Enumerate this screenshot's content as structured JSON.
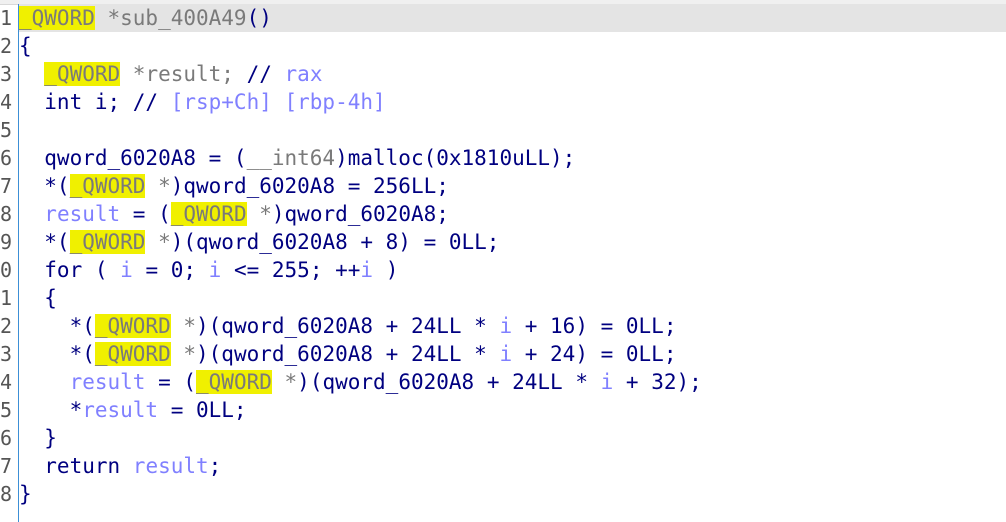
{
  "editor": {
    "current_line": 1,
    "colors": {
      "keyword": "#000080",
      "type": "#7a7a7a",
      "variable": "#8080ff",
      "highlight": "#f0f000"
    },
    "lines": [
      {
        "num": "1",
        "tokens": [
          [
            "_QWORD",
            "h"
          ],
          [
            " *sub_400A49",
            "t"
          ],
          [
            "()",
            "k"
          ]
        ]
      },
      {
        "num": "2",
        "tokens": [
          [
            "{",
            "k"
          ]
        ]
      },
      {
        "num": "3",
        "tokens": [
          [
            "  ",
            "k"
          ],
          [
            "_QWORD",
            "h"
          ],
          [
            " *result; ",
            "t"
          ],
          [
            "// ",
            "k"
          ],
          [
            "rax",
            "v"
          ]
        ]
      },
      {
        "num": "4",
        "tokens": [
          [
            "  int i; // ",
            "k"
          ],
          [
            "[rsp+Ch] [rbp-4h]",
            "v"
          ]
        ]
      },
      {
        "num": "5",
        "tokens": []
      },
      {
        "num": "6",
        "tokens": [
          [
            "  qword_6020A8 = (",
            "k"
          ],
          [
            "__int64",
            "t"
          ],
          [
            ")malloc(0x1810uLL);",
            "k"
          ]
        ]
      },
      {
        "num": "7",
        "tokens": [
          [
            "  *(",
            "k"
          ],
          [
            "_QWORD",
            "h"
          ],
          [
            " *",
            "t"
          ],
          [
            ")qword_6020A8 = 256LL;",
            "k"
          ]
        ]
      },
      {
        "num": "8",
        "tokens": [
          [
            "  ",
            "k"
          ],
          [
            "result",
            "v"
          ],
          [
            " = (",
            "k"
          ],
          [
            "_QWORD",
            "h"
          ],
          [
            " *",
            "t"
          ],
          [
            ")qword_6020A8;",
            "k"
          ]
        ]
      },
      {
        "num": "9",
        "tokens": [
          [
            "  *(",
            "k"
          ],
          [
            "_QWORD",
            "h"
          ],
          [
            " *",
            "t"
          ],
          [
            ")(qword_6020A8 + 8) = 0LL;",
            "k"
          ]
        ]
      },
      {
        "num": "0",
        "tokens": [
          [
            "  for ( ",
            "k"
          ],
          [
            "i",
            "v"
          ],
          [
            " = 0; ",
            "k"
          ],
          [
            "i",
            "v"
          ],
          [
            " <= 255; ++",
            "k"
          ],
          [
            "i",
            "v"
          ],
          [
            " )",
            "k"
          ]
        ]
      },
      {
        "num": "1",
        "tokens": [
          [
            "  {",
            "k"
          ]
        ]
      },
      {
        "num": "2",
        "tokens": [
          [
            "    *(",
            "k"
          ],
          [
            "_QWORD",
            "h"
          ],
          [
            " *",
            "t"
          ],
          [
            ")(qword_6020A8 + 24LL * ",
            "k"
          ],
          [
            "i",
            "v"
          ],
          [
            " + 16) = 0LL;",
            "k"
          ]
        ]
      },
      {
        "num": "3",
        "tokens": [
          [
            "    *(",
            "k"
          ],
          [
            "_QWORD",
            "h"
          ],
          [
            " *",
            "t"
          ],
          [
            ")(qword_6020A8 + 24LL * ",
            "k"
          ],
          [
            "i",
            "v"
          ],
          [
            " + 24) = 0LL;",
            "k"
          ]
        ]
      },
      {
        "num": "4",
        "tokens": [
          [
            "    ",
            "k"
          ],
          [
            "result",
            "v"
          ],
          [
            " = (",
            "k"
          ],
          [
            "_QWORD",
            "h"
          ],
          [
            " *",
            "t"
          ],
          [
            ")(qword_6020A8 + 24LL * ",
            "k"
          ],
          [
            "i",
            "v"
          ],
          [
            " + 32);",
            "k"
          ]
        ]
      },
      {
        "num": "5",
        "tokens": [
          [
            "    *",
            "k"
          ],
          [
            "result",
            "v"
          ],
          [
            " = 0LL;",
            "k"
          ]
        ]
      },
      {
        "num": "6",
        "tokens": [
          [
            "  }",
            "k"
          ]
        ]
      },
      {
        "num": "7",
        "tokens": [
          [
            "  return ",
            "k"
          ],
          [
            "result",
            "v"
          ],
          [
            ";",
            "k"
          ]
        ]
      },
      {
        "num": "8",
        "tokens": [
          [
            "}",
            "k"
          ]
        ]
      }
    ]
  }
}
